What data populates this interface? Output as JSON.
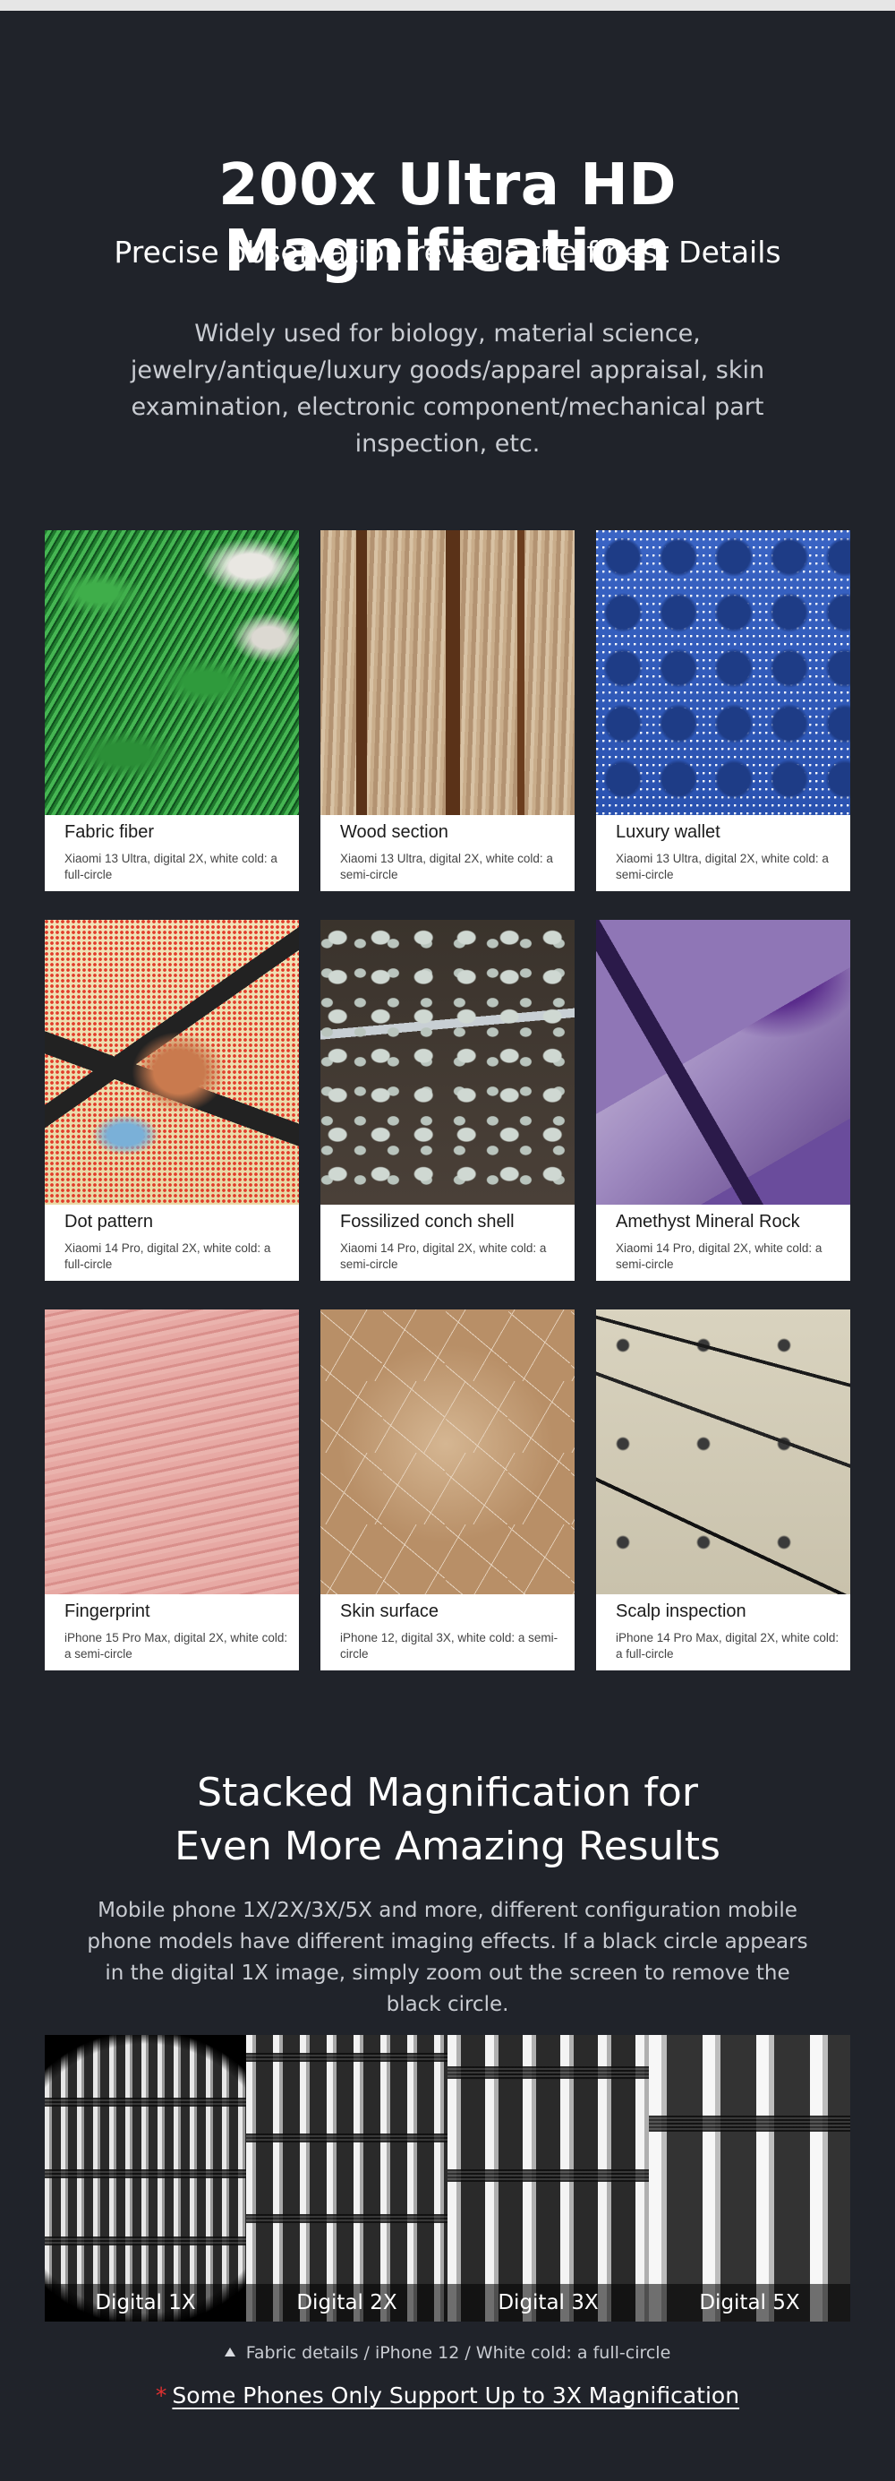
{
  "header": {
    "title": "200x Ultra HD Magnification",
    "subtitle": "Precise observation reveals the finest Details",
    "description": "Widely used for biology, material science, jewelry/antique/luxury goods/apparel appraisal, skin examination, electronic component/mechanical part inspection, etc."
  },
  "samples": [
    {
      "name": "Fabric fiber",
      "meta": "Xiaomi 13 Ultra, digital 2X, white cold: a full-circle",
      "texture": "fabric"
    },
    {
      "name": "Wood section",
      "meta": "Xiaomi 13 Ultra, digital 2X, white cold: a semi-circle",
      "texture": "wood"
    },
    {
      "name": "Luxury wallet",
      "meta": "Xiaomi 13 Ultra, digital 2X, white cold: a semi-circle",
      "texture": "wallet"
    },
    {
      "name": "Dot pattern",
      "meta": "Xiaomi 14 Pro, digital 2X, white cold: a full-circle",
      "texture": "dots"
    },
    {
      "name": "Fossilized conch shell",
      "meta": "Xiaomi 14 Pro, digital 2X, white cold: a semi-circle",
      "texture": "shell"
    },
    {
      "name": "Amethyst Mineral Rock",
      "meta": "Xiaomi 14 Pro, digital 2X, white cold: a semi-circle",
      "texture": "amethyst"
    },
    {
      "name": "Fingerprint",
      "meta": "iPhone 15 Pro Max, digital 2X, white cold: a semi-circle",
      "texture": "finger"
    },
    {
      "name": "Skin surface",
      "meta": "iPhone 12, digital 3X, white cold: a semi-circle",
      "texture": "skin"
    },
    {
      "name": "Scalp inspection",
      "meta": "iPhone 14 Pro Max, digital 2X, white cold: a full-circle",
      "texture": "scalp"
    }
  ],
  "stacked": {
    "title_line1": "Stacked Magnification for",
    "title_line2": "Even More Amazing Results",
    "description": "Mobile phone 1X/2X/3X/5X and more, different configuration mobile phone models have different imaging effects. If a black circle appears in the digital 1X image, simply zoom out the screen to remove the black circle."
  },
  "comparison": {
    "labels": [
      "Digital 1X",
      "Digital 2X",
      "Digital 3X",
      "Digital 5X"
    ],
    "caption": "Fabric details / iPhone 12 / White cold: a full-circle",
    "caption_icon": "triangle-up-icon"
  },
  "note": {
    "marker": "*",
    "text": "Some Phones Only Support Up to 3X Magnification",
    "marker_color": "#e03030"
  }
}
